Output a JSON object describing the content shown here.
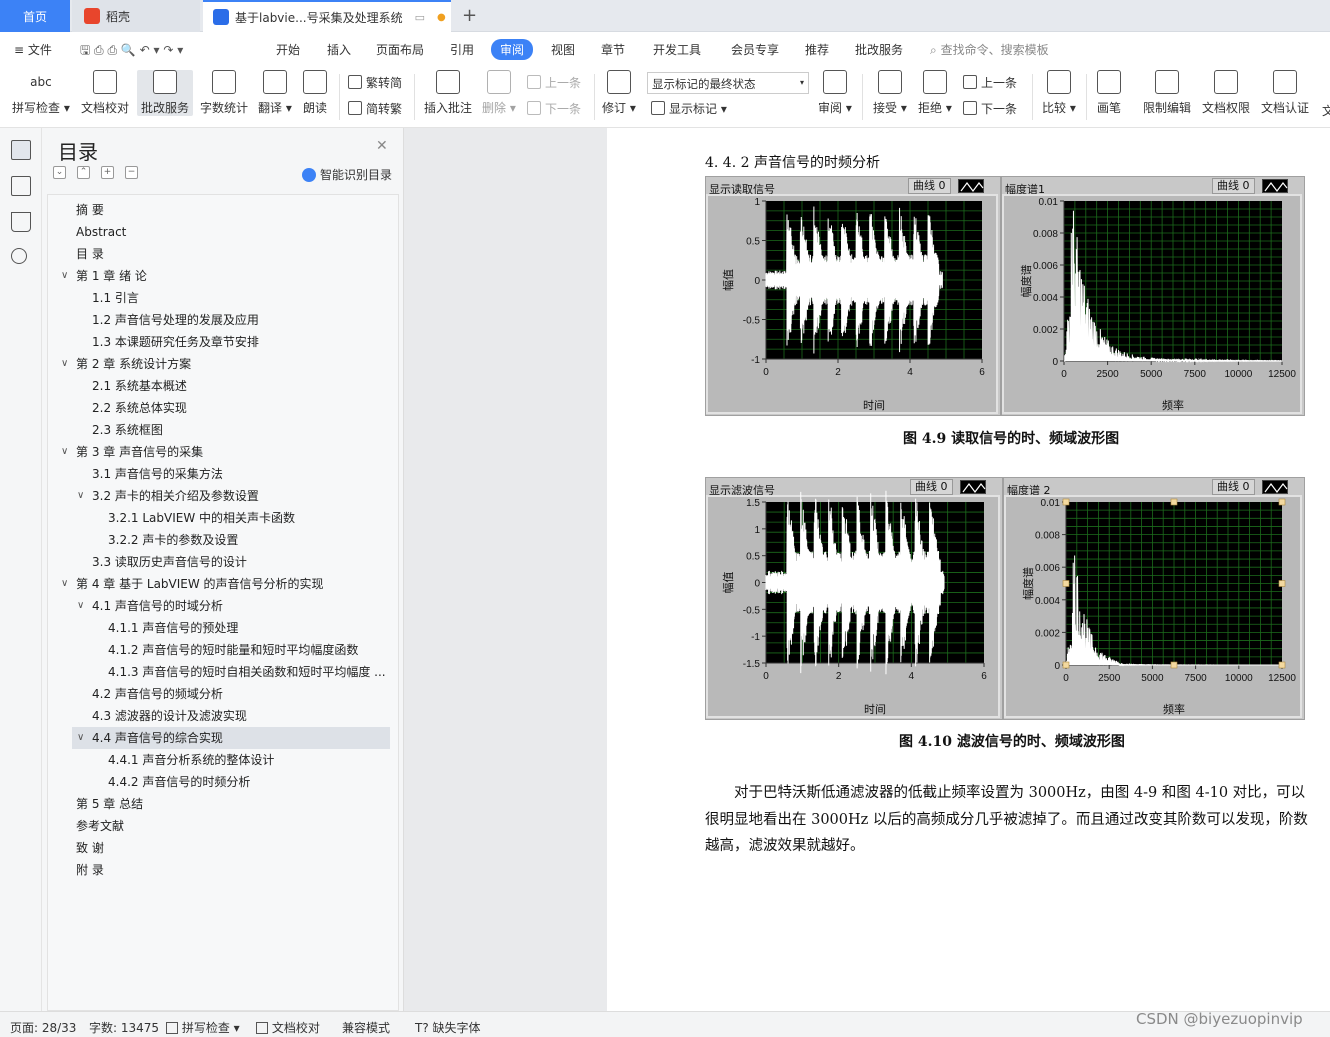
{
  "tabs": {
    "home": "首页",
    "daoke": "稻壳",
    "doc": "基于labvie...号采集及处理系统"
  },
  "colors": {
    "accent": "#3c82f6",
    "daoke_icon": "#e8452c",
    "doc_icon": "#2b6de8",
    "unsaved_dot": "#f0a020"
  },
  "menu": {
    "file": "文件",
    "items": [
      "开始",
      "插入",
      "页面布局",
      "引用",
      "审阅",
      "视图",
      "章节",
      "开发工具",
      "会员专享",
      "推荐",
      "批改服务"
    ],
    "search": "查找命令、搜索模板"
  },
  "ribbon": {
    "spell": "拼写检查",
    "proofread": "文档校对",
    "review_service": "批改服务",
    "word_count": "字数统计",
    "translate": "翻译",
    "read_aloud": "朗读",
    "to_traditional": "繁转简",
    "to_simplified": "简转繁",
    "insert_comment": "插入批注",
    "delete": "删除",
    "prev": "上一条",
    "next": "下一条",
    "revise": "修订",
    "markup_select": "显示标记的最终状态",
    "show_markup": "显示标记",
    "review_pane": "审阅",
    "accept": "接受",
    "reject": "拒绝",
    "prev2": "上一条",
    "next2": "下一条",
    "compare": "比较",
    "pen": "画笔",
    "restrict": "限制编辑",
    "doc_rights": "文档权限",
    "doc_cert": "文档认证",
    "more": "文"
  },
  "toc": {
    "title": "目录",
    "smart": "智能识别目录",
    "items": [
      {
        "text": "摘    要"
      },
      {
        "text": "Abstract"
      },
      {
        "text": "目    录"
      },
      {
        "text": "第 1 章  绪  论",
        "car": "∨"
      },
      {
        "text": "1.1  引言"
      },
      {
        "text": "1.2  声音信号处理的发展及应用"
      },
      {
        "text": "1.3  本课题研究任务及章节安排"
      },
      {
        "text": "第 2 章  系统设计方案",
        "car": "∨"
      },
      {
        "text": "2.1 系统基本概述"
      },
      {
        "text": "2.2 系统总体实现"
      },
      {
        "text": "2.3 系统框图"
      },
      {
        "text": "第 3 章  声音信号的采集",
        "car": "∨"
      },
      {
        "text": "3.1  声音信号的采集方法"
      },
      {
        "text": "3.2  声卡的相关介绍及参数设置",
        "car": "∨"
      },
      {
        "text": "3.2.1 LabVIEW 中的相关声卡函数"
      },
      {
        "text": "3.2.2 声卡的参数及设置"
      },
      {
        "text": "3.3  读取历史声音信号的设计"
      },
      {
        "text": "第 4 章  基于 LabVIEW 的声音信号分析的实现",
        "car": "∨"
      },
      {
        "text": "4.1 声音信号的时域分析",
        "car": "∨"
      },
      {
        "text": "4.1.1 声音信号的预处理"
      },
      {
        "text": "4.1.2 声音信号的短时能量和短时平均幅度函数"
      },
      {
        "text": "4.1.3 声音信号的短时自相关函数和短时平均幅度 ..."
      },
      {
        "text": "4.2 声音信号的频域分析"
      },
      {
        "text": "4.3 滤波器的设计及滤波实现"
      },
      {
        "text": "4.4 声音信号的综合实现",
        "car": "∨",
        "selected": true
      },
      {
        "text": "4.4.1 声音分析系统的整体设计"
      },
      {
        "text": "4.4.2 声音信号的时频分析"
      },
      {
        "text": "第 5 章  总结"
      },
      {
        "text": "参考文献"
      },
      {
        "text": "致    谢"
      },
      {
        "text": "附    录"
      }
    ]
  },
  "doc": {
    "section_heading": "4. 4. 2 声音信号的时频分析",
    "fig1_caption": "图 4.9  读取信号的时、频域波形图",
    "fig2_caption": "图 4.10  滤波信号的时、频域波形图",
    "paragraph": "对于巴特沃斯低通滤波器的低截止频率设置为 3000Hz，由图 4-9 和图 4-10 对比，可以很明显地看出在 3000Hz 以后的高频成分几乎被滤掉了。而且通过改变其阶数可以发现，阶数越高，滤波效果就越好。"
  },
  "chart_data": [
    {
      "type": "line",
      "title": "显示读取信号",
      "legend": "曲线 0",
      "xlabel": "时间",
      "ylabel": "幅值",
      "xlim": [
        0,
        6
      ],
      "ylim": [
        -1,
        1
      ],
      "xticks": [
        "0",
        "2",
        "4",
        "6"
      ],
      "yticks": [
        "1",
        "0.5",
        "0",
        "-0.5",
        "-1"
      ],
      "grid": true,
      "background": "#000000",
      "line_color": "#ffffff"
    },
    {
      "type": "line",
      "title": "幅度谱1",
      "legend": "曲线 0",
      "xlabel": "频率",
      "ylabel": "幅度谱",
      "xlim": [
        0,
        12500
      ],
      "ylim": [
        0,
        0.01
      ],
      "xticks": [
        "0",
        "2500",
        "5000",
        "7500",
        "10000",
        "12500"
      ],
      "yticks": [
        "0.01",
        "0.008",
        "0.006",
        "0.004",
        "0.002",
        "0"
      ],
      "grid": true,
      "background": "#000000",
      "line_color": "#ffffff"
    },
    {
      "type": "line",
      "title": "显示滤波信号",
      "legend": "曲线 0",
      "xlabel": "时间",
      "ylabel": "幅值",
      "xlim": [
        0,
        6
      ],
      "ylim": [
        -1.5,
        1.5
      ],
      "xticks": [
        "0",
        "2",
        "4",
        "6"
      ],
      "yticks": [
        "1.5",
        "1",
        "0.5",
        "0",
        "-0.5",
        "-1",
        "-1.5"
      ],
      "grid": true,
      "background": "#000000",
      "line_color": "#ffffff"
    },
    {
      "type": "line",
      "title": "幅度谱 2",
      "legend": "曲线 0",
      "xlabel": "频率",
      "ylabel": "幅度谱",
      "xlim": [
        0,
        12500
      ],
      "ylim": [
        0,
        0.01
      ],
      "xticks": [
        "0",
        "2500",
        "5000",
        "7500",
        "10000",
        "12500"
      ],
      "yticks": [
        "0.01",
        "0.008",
        "0.006",
        "0.004",
        "0.002",
        "0"
      ],
      "grid": true,
      "background": "#000000",
      "line_color": "#ffffff"
    }
  ],
  "status": {
    "page": "页面: 28/33",
    "words": "字数: 13475",
    "spell": "拼写检查",
    "proof": "文档校对",
    "compat": "兼容模式",
    "missing_font": "缺失字体"
  },
  "watermark": "CSDN @biyezuopinvip"
}
